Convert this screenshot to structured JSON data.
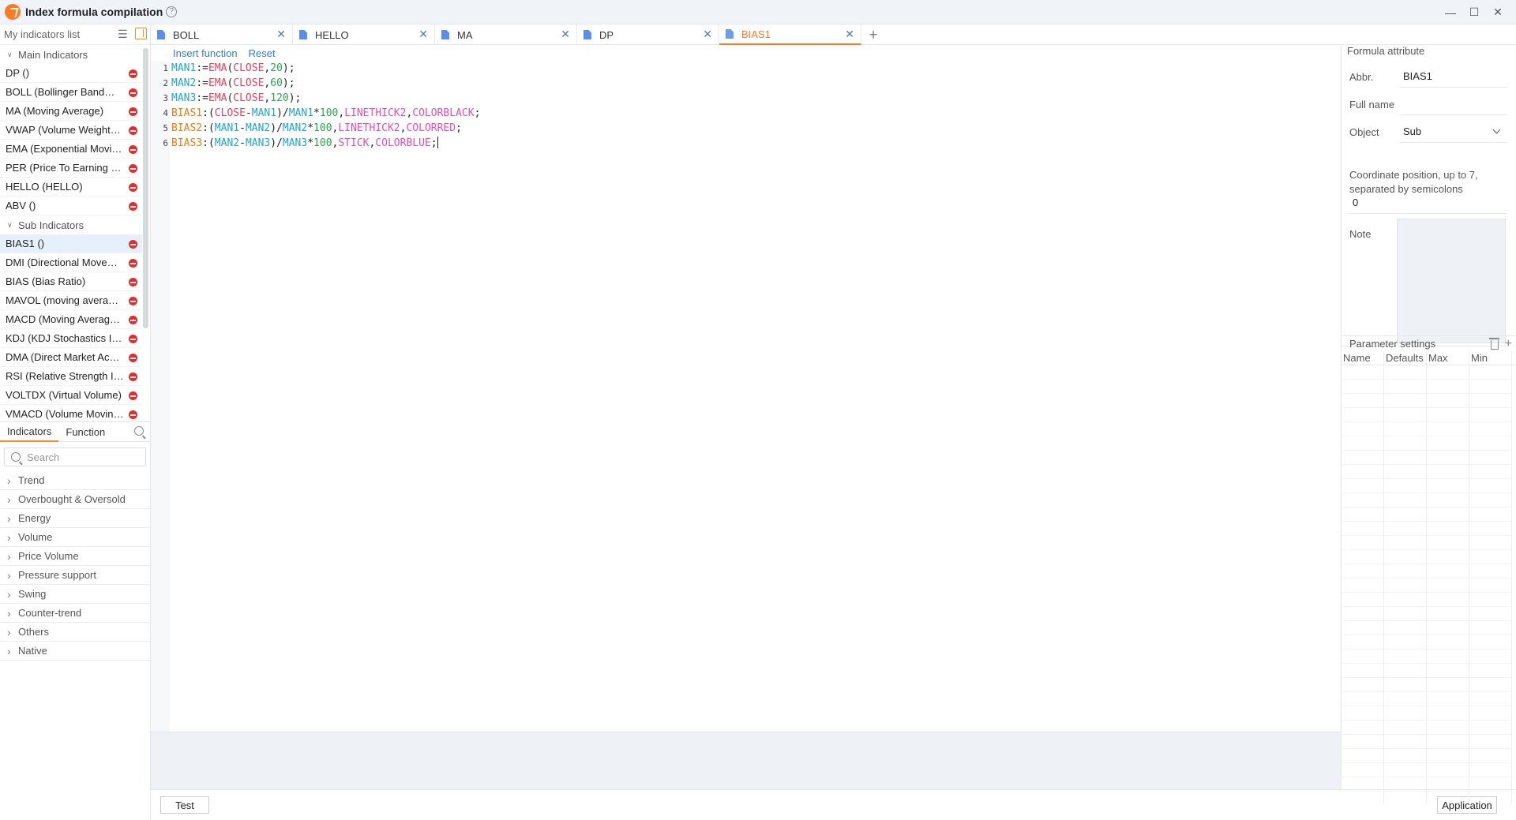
{
  "app": {
    "title": "Index formula compilation",
    "help": "?",
    "controls": {
      "minimize": "—",
      "maximize": "☐",
      "close": "✕"
    }
  },
  "left": {
    "title": "My indicators list",
    "groups": [
      {
        "label": "Main Indicators",
        "items": [
          "DP ()",
          "BOLL (Bollinger BandWidth)",
          "MA (Moving Average)",
          "VWAP (Volume Weighted Average Price)",
          "EMA (Exponential Moving Average)",
          "PER (Price To Earning Ratio)",
          "HELLO (HELLO)",
          "ABV ()"
        ]
      },
      {
        "label": "Sub Indicators",
        "items": [
          "BIAS1 ()",
          "DMI (Directional Movement Index)",
          "BIAS (Bias Ratio)",
          "MAVOL (moving average volume)",
          "MACD (Moving Average Convergence Divergence)",
          "KDJ (KDJ Stochastics Indicator)",
          "DMA (Direct Market Access)",
          "RSI (Relative Strength Index)",
          "VOLTDX (Virtual Volume)",
          "VMACD (Volume Moving Average)"
        ]
      }
    ],
    "selected": "BIAS1 ()",
    "tabs": [
      "Indicators",
      "Function"
    ],
    "search_placeholder": "Search",
    "categories": [
      "Trend",
      "Overbought & Oversold",
      "Energy",
      "Volume",
      "Price Volume",
      "Pressure support",
      "Swing",
      "Counter-trend",
      "Others",
      "Native"
    ]
  },
  "tabs": [
    {
      "label": "BOLL",
      "close": "✕"
    },
    {
      "label": "HELLO",
      "close": "✕"
    },
    {
      "label": "MA",
      "close": "✕"
    },
    {
      "label": "DP",
      "close": "✕"
    },
    {
      "label": "BIAS1",
      "close": "✕"
    }
  ],
  "tab_add": "+",
  "editor": {
    "insert_function": "Insert function",
    "reset": "Reset",
    "lines": [
      [
        [
          "id",
          "MAN1"
        ],
        [
          "op",
          ":="
        ],
        [
          "fn",
          "EMA"
        ],
        [
          "op",
          "("
        ],
        [
          "fn",
          "CLOSE"
        ],
        [
          "op",
          ","
        ],
        [
          "num",
          "20"
        ],
        [
          "op",
          ");"
        ]
      ],
      [
        [
          "id",
          "MAN2"
        ],
        [
          "op",
          ":="
        ],
        [
          "fn",
          "EMA"
        ],
        [
          "op",
          "("
        ],
        [
          "fn",
          "CLOSE"
        ],
        [
          "op",
          ","
        ],
        [
          "num",
          "60"
        ],
        [
          "op",
          ");"
        ]
      ],
      [
        [
          "id",
          "MAN3"
        ],
        [
          "op",
          ":="
        ],
        [
          "fn",
          "EMA"
        ],
        [
          "op",
          "("
        ],
        [
          "fn",
          "CLOSE"
        ],
        [
          "op",
          ","
        ],
        [
          "num",
          "120"
        ],
        [
          "op",
          ");"
        ]
      ],
      [
        [
          "out",
          "BIAS1"
        ],
        [
          "op",
          ":("
        ],
        [
          "fn",
          "CLOSE"
        ],
        [
          "op",
          "-"
        ],
        [
          "id",
          "MAN1"
        ],
        [
          "op",
          ")/"
        ],
        [
          "id",
          "MAN1"
        ],
        [
          "op",
          "*"
        ],
        [
          "num",
          "100"
        ],
        [
          "op",
          ","
        ],
        [
          "kw",
          "LINETHICK2"
        ],
        [
          "op",
          ","
        ],
        [
          "kw",
          "COLORBLACK"
        ],
        [
          "op",
          ";"
        ]
      ],
      [
        [
          "out",
          "BIAS2"
        ],
        [
          "op",
          ":("
        ],
        [
          "id",
          "MAN1"
        ],
        [
          "op",
          "-"
        ],
        [
          "id",
          "MAN2"
        ],
        [
          "op",
          ")/"
        ],
        [
          "id",
          "MAN2"
        ],
        [
          "op",
          "*"
        ],
        [
          "num",
          "100"
        ],
        [
          "op",
          ","
        ],
        [
          "kw",
          "LINETHICK2"
        ],
        [
          "op",
          ","
        ],
        [
          "kw",
          "COLORRED"
        ],
        [
          "op",
          ";"
        ]
      ],
      [
        [
          "out",
          "BIAS3"
        ],
        [
          "op",
          ":("
        ],
        [
          "id",
          "MAN2"
        ],
        [
          "op",
          "-"
        ],
        [
          "id",
          "MAN3"
        ],
        [
          "op",
          ")/"
        ],
        [
          "id",
          "MAN3"
        ],
        [
          "op",
          "*"
        ],
        [
          "num",
          "100"
        ],
        [
          "op",
          ","
        ],
        [
          "kw",
          "STICK"
        ],
        [
          "op",
          ","
        ],
        [
          "kw",
          "COLORBLUE"
        ],
        [
          "op",
          ";"
        ]
      ]
    ],
    "line_numbers": [
      "1",
      "2",
      "3",
      "4",
      "5",
      "6"
    ]
  },
  "attributes": {
    "header": "Formula attribute",
    "abbr_label": "Abbr.",
    "abbr_value": "BIAS1",
    "fullname_label": "Full name",
    "fullname_value": "",
    "object_label": "Object",
    "object_value": "Sub",
    "coord_label": "Coordinate position, up to 7, separated by semicolons",
    "coord_value": "0",
    "note_label": "Note"
  },
  "params": {
    "header": "Parameter settings",
    "columns": [
      "Name",
      "Defaults",
      "Max",
      "Min"
    ]
  },
  "buttons": {
    "test": "Test",
    "application": "Application"
  }
}
